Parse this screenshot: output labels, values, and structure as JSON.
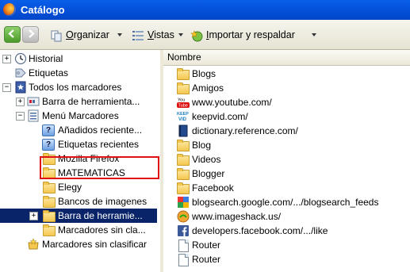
{
  "window": {
    "title": "Catálogo"
  },
  "toolbar": {
    "organizar": "Organizar",
    "vistas": "Vistas",
    "importar": "Importar y respaldar"
  },
  "tree": {
    "historial": "Historial",
    "etiquetas": "Etiquetas",
    "todos": "Todos los marcadores",
    "barra": "Barra de herramienta...",
    "menu": "Menú Marcadores",
    "anadidos": "Añadidos reciente...",
    "etiquetas_recientes": "Etiquetas recientes",
    "mozilla": "Mozilla Firefox",
    "matematicas": "MATEMATICAS",
    "elegy": "Elegy",
    "bancos": "Bancos de imagenes",
    "barra_sel": "Barra de herramie...",
    "sin_clasificar_sub": "Marcadores sin cla...",
    "sin_clasificar": "Marcadores sin clasificar"
  },
  "list": {
    "column_name": "Nombre",
    "items": [
      "Blogs",
      "Amigos",
      "www.youtube.com/",
      "keepvid.com/",
      "dictionary.reference.com/",
      "Blog",
      "Videos",
      "Blogger",
      "Facebook",
      "blogsearch.google.com/.../blogsearch_feeds",
      "www.imageshack.us/",
      "developers.facebook.com/.../like",
      "Router",
      "Router"
    ]
  }
}
